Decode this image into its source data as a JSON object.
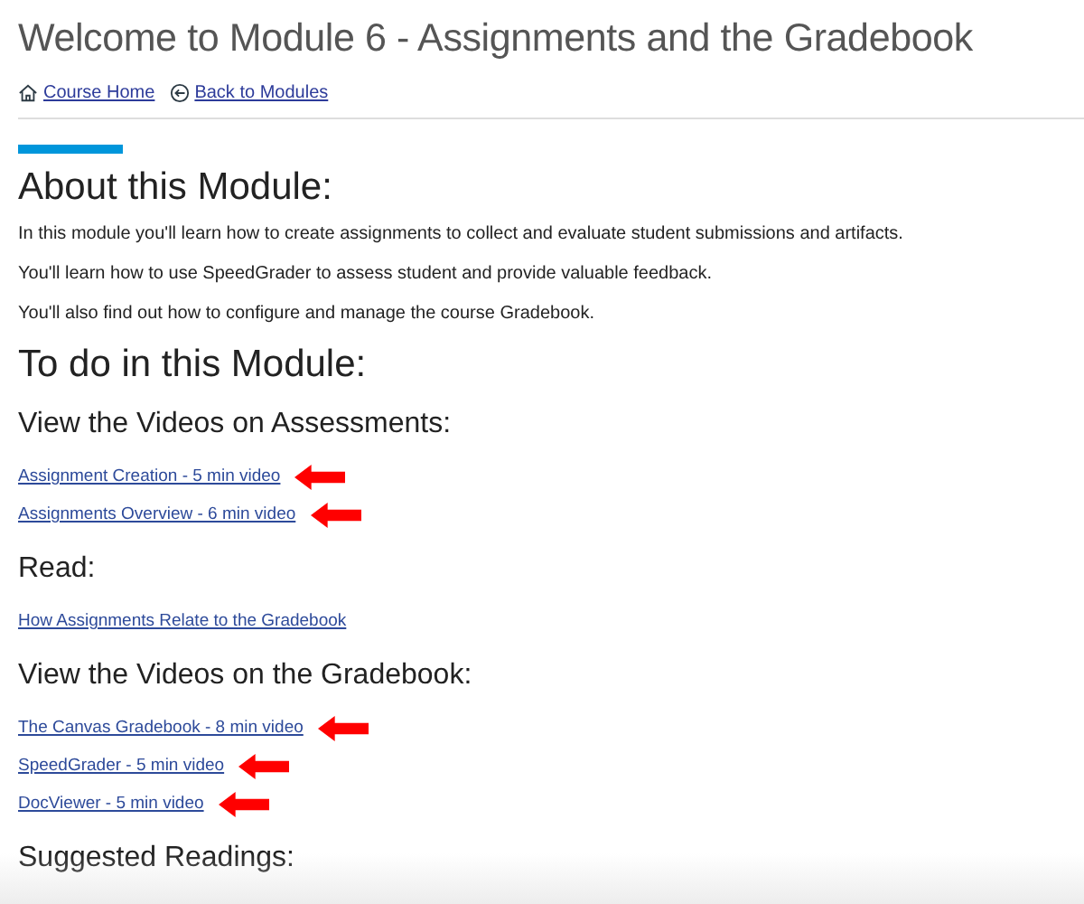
{
  "title": "Welcome to Module 6 - Assignments and the Gradebook",
  "nav_links": [
    {
      "kind": "home",
      "label": "Course Home"
    },
    {
      "kind": "back",
      "label": "Back to Modules"
    }
  ],
  "sections": [
    {
      "kind": "main",
      "heading": "About this Module:",
      "items": [
        {
          "kind": "paragraph",
          "text": "In this module you'll learn how to create assignments to collect and evaluate student submissions and artifacts."
        },
        {
          "kind": "paragraph",
          "text": "You'll learn how to use SpeedGrader to assess student and provide valuable feedback."
        },
        {
          "kind": "paragraph",
          "text": "You'll also find out how to configure and manage the course Gradebook."
        }
      ]
    },
    {
      "kind": "main",
      "heading": "To do in this Module:"
    },
    {
      "kind": "sub",
      "heading": "View the Videos on Assessments:",
      "items": [
        {
          "kind": "link",
          "text": "Assignment Creation - 5 min video",
          "arrow": true
        },
        {
          "kind": "link",
          "text": "Assignments Overview - 6 min video",
          "arrow": true
        }
      ]
    },
    {
      "kind": "sub",
      "heading": "Read:",
      "items": [
        {
          "kind": "link",
          "text": "How Assignments Relate to the Gradebook",
          "arrow": false
        }
      ]
    },
    {
      "kind": "sub",
      "heading": "View the Videos on the Gradebook:",
      "items": [
        {
          "kind": "link",
          "text": "The Canvas Gradebook - 8 min video",
          "arrow": true
        },
        {
          "kind": "link",
          "text": "SpeedGrader - 5 min video",
          "arrow": true
        },
        {
          "kind": "link",
          "text": "DocViewer - 5 min video",
          "arrow": true
        }
      ]
    },
    {
      "kind": "sub",
      "heading": "Suggested Readings:"
    }
  ]
}
